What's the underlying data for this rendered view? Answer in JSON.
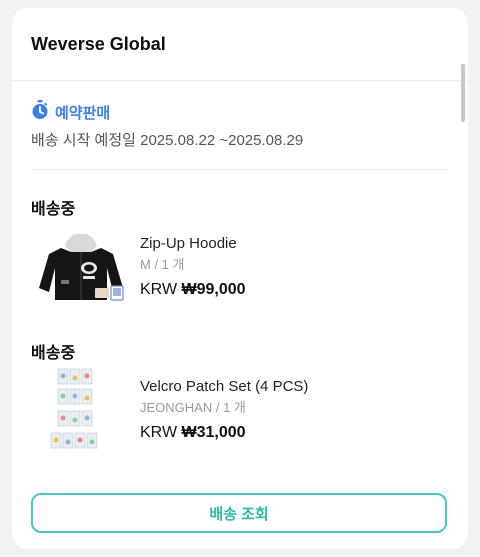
{
  "header": {
    "title": "Weverse Global"
  },
  "preorder": {
    "label": "예약판매",
    "ship_date": "배송 시작 예정일 2025.08.22 ~2025.08.29"
  },
  "orders": [
    {
      "status": "배송중",
      "name": "Zip-Up Hoodie",
      "option": "M / 1 개",
      "currency": "KRW",
      "price": "₩99,000"
    },
    {
      "status": "배송중",
      "name": "Velcro Patch Set (4 PCS)",
      "option": "JEONGHAN / 1 개",
      "currency": "KRW",
      "price": "₩31,000"
    }
  ],
  "actions": {
    "track_label": "배송 조회"
  },
  "colors": {
    "accent_blue": "#3f7de6",
    "accent_teal": "#2fb9b0"
  },
  "icons": {
    "preorder": "stopwatch-icon"
  }
}
